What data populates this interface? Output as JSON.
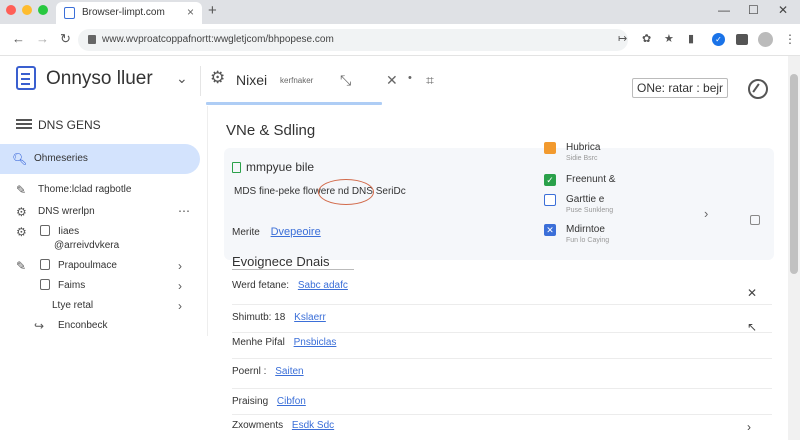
{
  "browser": {
    "tab_title": "Browser-limpt.com",
    "tab_close": "×",
    "new_tab": "+",
    "window_controls": [
      "—",
      "☐",
      "✕"
    ],
    "url": "www.wvproatcoppafnortt:wwgletjcom/bhpopese.com",
    "nav": {
      "back": "←",
      "forward": "→",
      "reload": "↻"
    },
    "toolbar_icons": [
      "share-icon",
      "puzzle-icon",
      "star-icon",
      "bookmark-icon"
    ],
    "ext_menu": "⋮"
  },
  "header": {
    "app_title": "Onnyso lluer",
    "tab_label": "Nixei",
    "tab_sub": "kerfnaker",
    "right_button": "ONe: ratar : bejr"
  },
  "sidebar": {
    "section_label": "DNS GENS",
    "items": [
      {
        "label": "Ohmeseries",
        "icon": "search-icon",
        "active": true
      },
      {
        "label": "Thome:lclad ragbotle",
        "icon": "pencil-icon"
      },
      {
        "label": "DNS wrerlpn",
        "icon": "gear-icon",
        "extra": "⋯"
      },
      {
        "label": "Iiaes",
        "icon": "gear-icon"
      },
      {
        "label": "@arreivdvkera",
        "icon": ""
      },
      {
        "label": "Prapoulmace",
        "icon": "pencil-icon",
        "extra": "›"
      },
      {
        "label": "Faims",
        "icon": "",
        "extra": "›"
      },
      {
        "label": "Ltye retal",
        "icon": "",
        "extra": "›"
      },
      {
        "label": "Enconbeck",
        "icon": "return-icon"
      }
    ]
  },
  "main": {
    "title": "VNe & Sdling",
    "card": {
      "title": "mmpyue bile",
      "line": "MDS fine-peke flowere nd DNS SeriDc",
      "row_label": "Merite",
      "row_link": "Dvepeoire",
      "chevron": "›"
    },
    "panel": [
      {
        "title": "Hubrica",
        "sub": "Sidie Bsrc",
        "color": "#f29a2e",
        "glyph": ""
      },
      {
        "title": "Freenunt &",
        "sub": "",
        "color": "#2aa14a",
        "glyph": "✓"
      },
      {
        "title": "Garttie e",
        "sub": "Puse Sunkleng",
        "color": "#3b6fd8",
        "glyph": ""
      },
      {
        "title": "Mdirntoe",
        "sub": "Fun lo Caying",
        "color": "#3b6fd8",
        "glyph": "✕"
      }
    ],
    "section_title": "Evoignece Dnais",
    "fields": [
      {
        "label": "Werd fetane:",
        "value": "Sabc adafc",
        "icon": "✕"
      },
      {
        "label": "Shimutb: 18",
        "value": "Kslaerr",
        "icon": "↖"
      },
      {
        "label": "Menhe Pifal",
        "value": "Pnsbiclas",
        "icon": ""
      },
      {
        "label": "Poernl :",
        "value": "Saiten",
        "icon": ""
      },
      {
        "label": "Praising",
        "value": "Cibfon",
        "icon": ""
      },
      {
        "label": "Zxowments",
        "value": "Esdk Sdc",
        "icon": "›"
      }
    ]
  }
}
